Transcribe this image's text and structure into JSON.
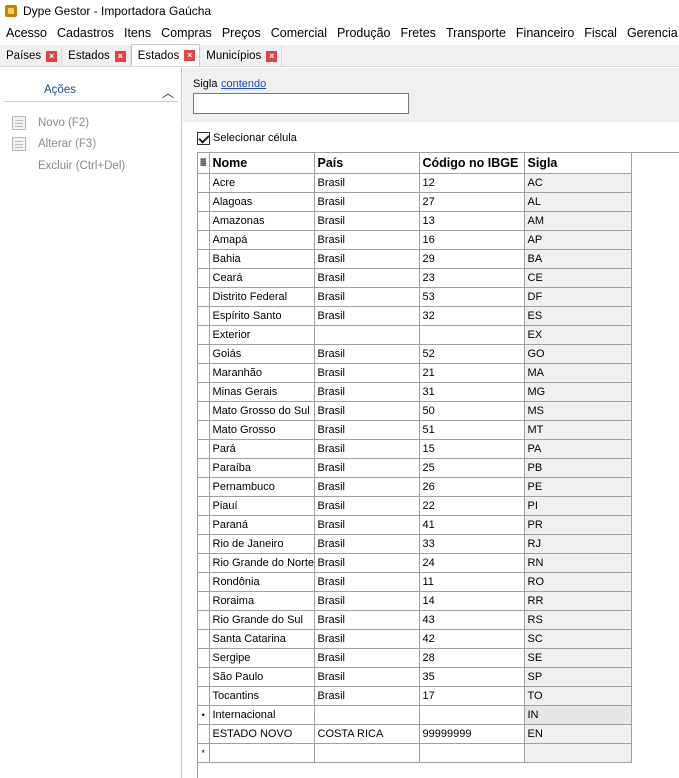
{
  "window": {
    "title": "Dype Gestor - Importadora Gaúcha"
  },
  "menu": [
    "Acesso",
    "Cadastros",
    "Itens",
    "Compras",
    "Preços",
    "Comercial",
    "Produção",
    "Fretes",
    "Transporte",
    "Financeiro",
    "Fiscal",
    "Gerencia"
  ],
  "tabs": [
    {
      "label": "Países",
      "active": false
    },
    {
      "label": "Estados",
      "active": false
    },
    {
      "label": "Estados",
      "active": true
    },
    {
      "label": "Municípios",
      "active": false
    }
  ],
  "sidebar": {
    "title": "Ações",
    "actions": [
      {
        "label": "Novo (F2)",
        "icon": "new-document-icon"
      },
      {
        "label": "Alterar (F3)",
        "icon": "edit-document-icon"
      },
      {
        "label": "Excluir (Ctrl+Del)",
        "icon": ""
      }
    ]
  },
  "filter": {
    "label": "Sigla",
    "mode_link": "contendo",
    "value": "",
    "placeholder": ""
  },
  "select_cell": {
    "label": "Selecionar célula",
    "checked": true
  },
  "grid": {
    "columns": [
      "Nome",
      "País",
      "Código no IBGE",
      "Sigla"
    ],
    "rows": [
      [
        "Acre",
        "Brasil",
        "12",
        "AC"
      ],
      [
        "Alagoas",
        "Brasil",
        "27",
        "AL"
      ],
      [
        "Amazonas",
        "Brasil",
        "13",
        "AM"
      ],
      [
        "Amapá",
        "Brasil",
        "16",
        "AP"
      ],
      [
        "Bahia",
        "Brasil",
        "29",
        "BA"
      ],
      [
        "Ceará",
        "Brasil",
        "23",
        "CE"
      ],
      [
        "Distrito Federal",
        "Brasil",
        "53",
        "DF"
      ],
      [
        "Espírito Santo",
        "Brasil",
        "32",
        "ES"
      ],
      [
        "Exterior",
        "",
        "",
        "EX"
      ],
      [
        "Goiás",
        "Brasil",
        "52",
        "GO"
      ],
      [
        "Maranhão",
        "Brasil",
        "21",
        "MA"
      ],
      [
        "Minas Gerais",
        "Brasil",
        "31",
        "MG"
      ],
      [
        "Mato Grosso do Sul",
        "Brasil",
        "50",
        "MS"
      ],
      [
        "Mato Grosso",
        "Brasil",
        "51",
        "MT"
      ],
      [
        "Pará",
        "Brasil",
        "15",
        "PA"
      ],
      [
        "Paraíba",
        "Brasil",
        "25",
        "PB"
      ],
      [
        "Pernambuco",
        "Brasil",
        "26",
        "PE"
      ],
      [
        "Piauí",
        "Brasil",
        "22",
        "PI"
      ],
      [
        "Paraná",
        "Brasil",
        "41",
        "PR"
      ],
      [
        "Rio de Janeiro",
        "Brasil",
        "33",
        "RJ"
      ],
      [
        "Rio Grande do Norte",
        "Brasil",
        "24",
        "RN"
      ],
      [
        "Rondônia",
        "Brasil",
        "11",
        "RO"
      ],
      [
        "Roraima",
        "Brasil",
        "14",
        "RR"
      ],
      [
        "Rio Grande do Sul",
        "Brasil",
        "43",
        "RS"
      ],
      [
        "Santa Catarina",
        "Brasil",
        "42",
        "SC"
      ],
      [
        "Sergipe",
        "Brasil",
        "28",
        "SE"
      ],
      [
        "São Paulo",
        "Brasil",
        "35",
        "SP"
      ],
      [
        "Tocantins",
        "Brasil",
        "17",
        "TO"
      ],
      [
        "Internacional",
        "",
        "",
        "IN"
      ],
      [
        "ESTADO NOVO",
        "COSTA RICA",
        "99999999",
        "EN"
      ]
    ],
    "selected_row_index": 28,
    "selected_marker": "•",
    "new_row_marker": "*",
    "header_marker": "≣"
  }
}
